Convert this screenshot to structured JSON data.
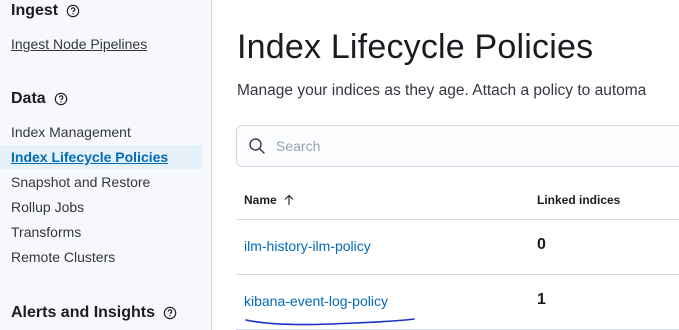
{
  "sidebar": {
    "ingest": {
      "title": "Ingest",
      "items": [
        "Ingest Node Pipelines"
      ]
    },
    "data": {
      "title": "Data",
      "items": [
        "Index Management",
        "Index Lifecycle Policies",
        "Snapshot and Restore",
        "Rollup Jobs",
        "Transforms",
        "Remote Clusters"
      ],
      "active": "Index Lifecycle Policies"
    },
    "alerts": {
      "title": "Alerts and Insights"
    }
  },
  "main": {
    "title": "Index Lifecycle Policies",
    "description": "Manage your indices as they age. Attach a policy to automa",
    "search": {
      "placeholder": "Search",
      "value": ""
    },
    "table": {
      "columns": [
        "Name",
        "Linked indices"
      ],
      "sort_icon": "arrow-up-icon",
      "rows": [
        {
          "name": "ilm-history-ilm-policy",
          "linked": "0"
        },
        {
          "name": "kibana-event-log-policy",
          "linked": "1"
        }
      ]
    }
  },
  "colors": {
    "link": "#006bb8",
    "active_bg": "#e6f1fa",
    "sidebar_bg": "#f7f8fc",
    "border": "#d3dae6",
    "annotation": "#1b2fc9"
  }
}
